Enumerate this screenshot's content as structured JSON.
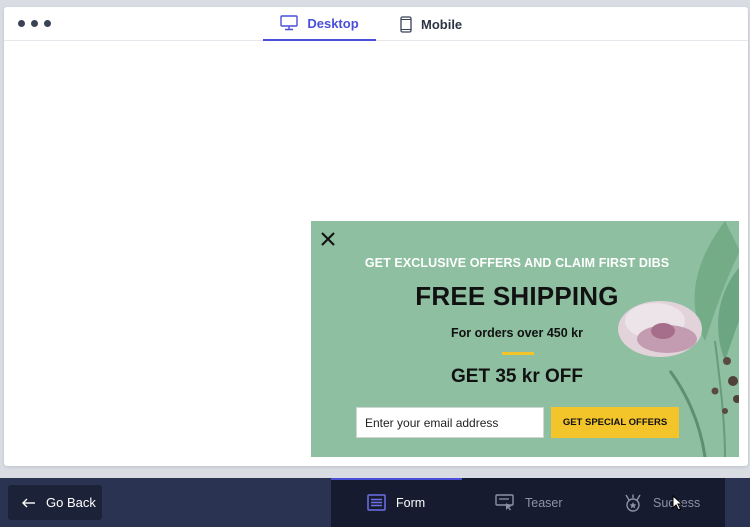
{
  "viewport_tabs": [
    {
      "label": "Desktop",
      "icon": "desktop-icon",
      "active": true
    },
    {
      "label": "Mobile",
      "icon": "mobile-icon",
      "active": false
    }
  ],
  "popup": {
    "eyebrow": "GET EXCLUSIVE OFFERS AND CLAIM FIRST DIBS",
    "headline": "FREE SHIPPING",
    "subheadline": "For orders over 450 kr",
    "offer": "GET 35 kr OFF",
    "email_placeholder": "Enter your email address",
    "cta_label": "GET SPECIAL OFFERS",
    "background": "#8dbfa0",
    "accent": "#f4c52a"
  },
  "bottom_bar": {
    "back_label": "Go Back",
    "steps": [
      {
        "label": "Form",
        "icon": "form-icon",
        "active": true
      },
      {
        "label": "Teaser",
        "icon": "teaser-icon",
        "active": false
      },
      {
        "label": "Success",
        "icon": "success-icon",
        "active": false
      }
    ],
    "accent": "#4a4fd8"
  }
}
